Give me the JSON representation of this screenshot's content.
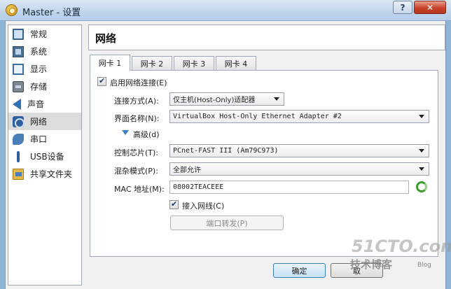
{
  "window": {
    "title": "Master - 设置",
    "help_label": "?",
    "close_label": "✕"
  },
  "sidebar": {
    "items": [
      {
        "label": "常规",
        "icon": "general-icon"
      },
      {
        "label": "系统",
        "icon": "system-icon"
      },
      {
        "label": "显示",
        "icon": "display-icon"
      },
      {
        "label": "存储",
        "icon": "storage-icon"
      },
      {
        "label": "声音",
        "icon": "audio-icon"
      },
      {
        "label": "网络",
        "icon": "network-icon",
        "selected": true
      },
      {
        "label": "串口",
        "icon": "serial-port-icon"
      },
      {
        "label": "USB设备",
        "icon": "usb-icon"
      },
      {
        "label": "共享文件夹",
        "icon": "shared-folder-icon"
      }
    ]
  },
  "page": {
    "title": "网络"
  },
  "tabs": [
    {
      "label": "网卡 1",
      "active": true
    },
    {
      "label": "网卡 2"
    },
    {
      "label": "网卡 3"
    },
    {
      "label": "网卡 4"
    }
  ],
  "adapter": {
    "enable_label": "启用网络连接(E)",
    "enable_checked": true,
    "attached_label": "连接方式(A):",
    "attached_value": "仅主机(Host-Only)适配器",
    "name_label": "界面名称(N):",
    "name_value": "VirtualBox Host-Only Ethernet Adapter #2",
    "advanced_label": "高级(d)",
    "adapter_type_label": "控制芯片(T):",
    "adapter_type_value": "PCnet-FAST III (Am79C973)",
    "promisc_label": "混杂模式(P):",
    "promisc_value": "全部允许",
    "mac_label": "MAC 地址(M):",
    "mac_value": "08002TEACEEE",
    "cable_label": "接入网线(C)",
    "cable_checked": true,
    "port_forward_label": "端口转发(P)"
  },
  "footer": {
    "ok_label": "确定",
    "cancel_label": "取"
  },
  "watermark": {
    "site": "51CTO.com",
    "tagline": "技术博客",
    "blog": "Blog"
  }
}
